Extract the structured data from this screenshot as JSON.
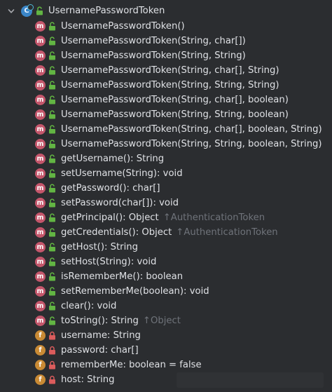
{
  "structure": {
    "class_name": "UsernamePasswordToken",
    "expanded": true
  },
  "members": [
    {
      "kind": "m",
      "access": "public",
      "label": "UsernamePasswordToken()",
      "inherited": ""
    },
    {
      "kind": "m",
      "access": "public",
      "label": "UsernamePasswordToken(String, char[])",
      "inherited": ""
    },
    {
      "kind": "m",
      "access": "public",
      "label": "UsernamePasswordToken(String, String)",
      "inherited": ""
    },
    {
      "kind": "m",
      "access": "public",
      "label": "UsernamePasswordToken(String, char[], String)",
      "inherited": ""
    },
    {
      "kind": "m",
      "access": "public",
      "label": "UsernamePasswordToken(String, String, String)",
      "inherited": ""
    },
    {
      "kind": "m",
      "access": "public",
      "label": "UsernamePasswordToken(String, char[], boolean)",
      "inherited": ""
    },
    {
      "kind": "m",
      "access": "public",
      "label": "UsernamePasswordToken(String, String, boolean)",
      "inherited": ""
    },
    {
      "kind": "m",
      "access": "public",
      "label": "UsernamePasswordToken(String, char[], boolean, String)",
      "inherited": ""
    },
    {
      "kind": "m",
      "access": "public",
      "label": "UsernamePasswordToken(String, String, boolean, String)",
      "inherited": ""
    },
    {
      "kind": "m",
      "access": "public",
      "label": "getUsername(): String",
      "inherited": ""
    },
    {
      "kind": "m",
      "access": "public",
      "label": "setUsername(String): void",
      "inherited": ""
    },
    {
      "kind": "m",
      "access": "public",
      "label": "getPassword(): char[]",
      "inherited": ""
    },
    {
      "kind": "m",
      "access": "public",
      "label": "setPassword(char[]): void",
      "inherited": ""
    },
    {
      "kind": "m",
      "access": "public",
      "label": "getPrincipal(): Object",
      "inherited": "AuthenticationToken"
    },
    {
      "kind": "m",
      "access": "public",
      "label": "getCredentials(): Object",
      "inherited": "AuthenticationToken"
    },
    {
      "kind": "m",
      "access": "public",
      "label": "getHost(): String",
      "inherited": ""
    },
    {
      "kind": "m",
      "access": "public",
      "label": "setHost(String): void",
      "inherited": ""
    },
    {
      "kind": "m",
      "access": "public",
      "label": "isRememberMe(): boolean",
      "inherited": ""
    },
    {
      "kind": "m",
      "access": "public",
      "label": "setRememberMe(boolean): void",
      "inherited": ""
    },
    {
      "kind": "m",
      "access": "public",
      "label": "clear(): void",
      "inherited": ""
    },
    {
      "kind": "m",
      "access": "public",
      "label": "toString(): String",
      "inherited": "Object"
    },
    {
      "kind": "f",
      "access": "private",
      "label": "username: String",
      "inherited": ""
    },
    {
      "kind": "f",
      "access": "private",
      "label": "password: char[]",
      "inherited": ""
    },
    {
      "kind": "f",
      "access": "private",
      "label": "rememberMe: boolean = false",
      "inherited": ""
    },
    {
      "kind": "f",
      "access": "private",
      "label": "host: String",
      "inherited": ""
    }
  ],
  "inherit_arrow": "↑",
  "colors": {
    "background": "#2b2d30",
    "method_badge": "#c4566b",
    "field_badge": "#c98a34",
    "public_lock": "#62b543",
    "private_lock": "#db5c5c",
    "class_icon": "#3b86c8",
    "inherited_text": "#6f737a"
  },
  "icons": {
    "expand": "chevron-down-icon",
    "class": "class-icon",
    "method": "method-icon",
    "field": "field-icon",
    "public": "unlocked-icon",
    "private": "locked-icon"
  }
}
